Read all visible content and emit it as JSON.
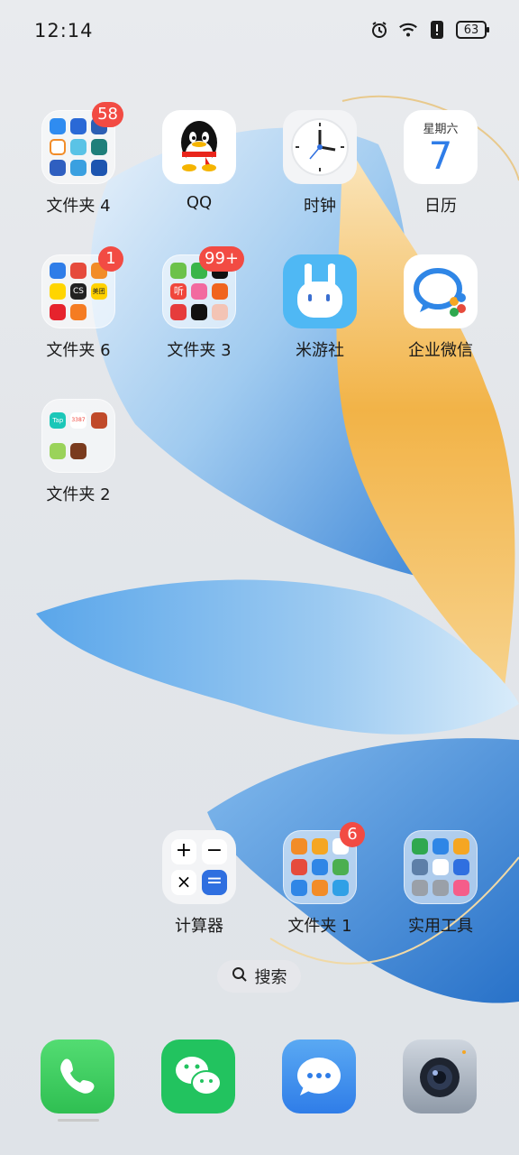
{
  "status_bar": {
    "time": "12:14",
    "battery": "63",
    "icons": [
      "alarm-icon",
      "wifi-icon",
      "alert-icon",
      "battery-icon"
    ]
  },
  "apps": [
    {
      "id": "folder4",
      "label": "文件夹 4",
      "badge": "58"
    },
    {
      "id": "qq",
      "label": "QQ"
    },
    {
      "id": "clock",
      "label": "时钟"
    },
    {
      "id": "calendar",
      "label": "日历",
      "weekday": "星期六",
      "day": "7"
    },
    {
      "id": "folder6",
      "label": "文件夹 6",
      "badge": "1",
      "mini": [
        "CS",
        "美团"
      ]
    },
    {
      "id": "folder3",
      "label": "文件夹 3",
      "badge": "99+",
      "mini": [
        "听"
      ]
    },
    {
      "id": "miyoushe",
      "label": "米游社"
    },
    {
      "id": "wecom",
      "label": "企业微信"
    },
    {
      "id": "folder2",
      "label": "文件夹 2",
      "mini": [
        "Tap",
        "3387"
      ]
    },
    {
      "id": "calculator",
      "label": "计算器"
    },
    {
      "id": "folder1",
      "label": "文件夹 1",
      "badge": "6"
    },
    {
      "id": "tools",
      "label": "实用工具"
    }
  ],
  "search": {
    "label": "搜索"
  },
  "dock": [
    "phone",
    "wechat",
    "messages",
    "camera"
  ],
  "colors": {
    "badge": "#f24b43",
    "wallpaper_blue": "#3f8fe0",
    "wallpaper_gold": "#f2a531"
  }
}
